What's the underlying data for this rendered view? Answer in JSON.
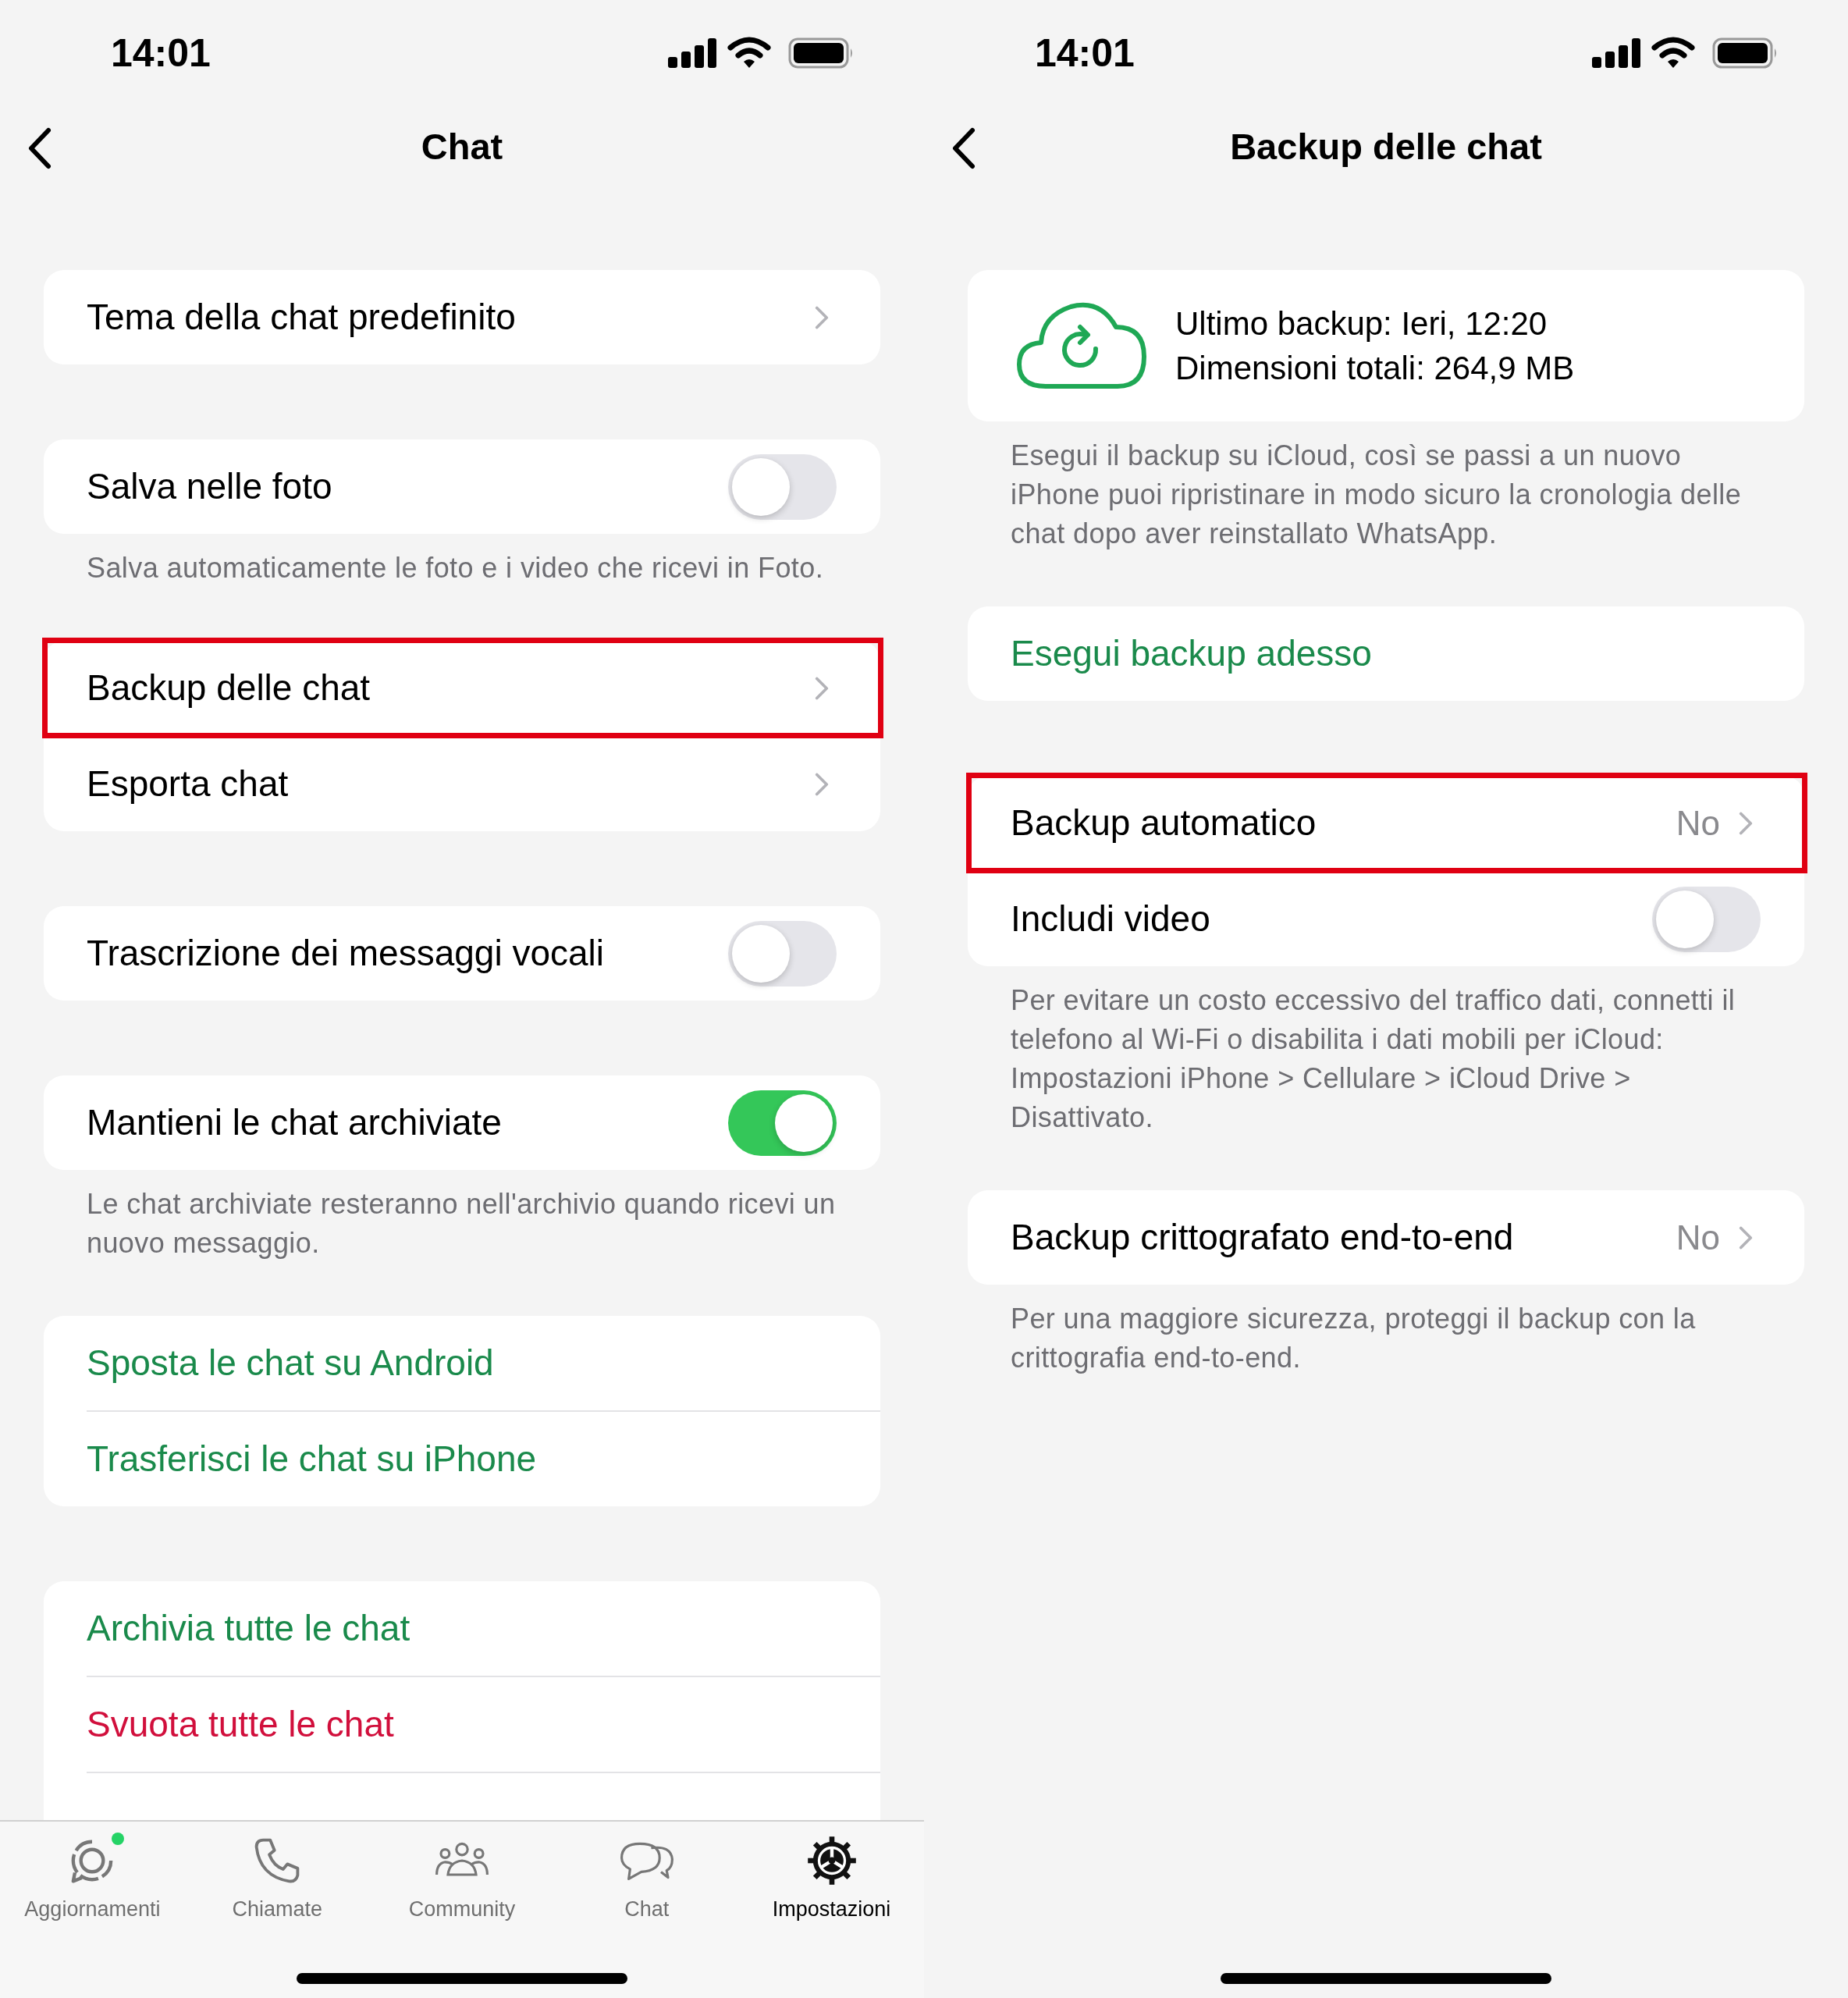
{
  "screens": [
    {
      "status_bar": {
        "time": "14:01"
      },
      "nav": {
        "title": "Chat"
      },
      "groups": [
        {
          "rows": [
            {
              "kind": "link",
              "label": "Tema della chat predefinito",
              "highlighted": false
            }
          ]
        },
        {
          "rows": [
            {
              "kind": "toggle",
              "label": "Salva nelle foto",
              "on": false
            }
          ],
          "footer": "Salva automaticamente le foto e i video che ricevi in Foto."
        },
        {
          "rows": [
            {
              "kind": "link",
              "label": "Backup delle chat",
              "highlighted": true
            },
            {
              "kind": "link",
              "label": "Esporta chat",
              "highlighted": false
            }
          ]
        },
        {
          "rows": [
            {
              "kind": "toggle",
              "label": "Trascrizione dei messaggi vocali",
              "on": false
            }
          ]
        },
        {
          "rows": [
            {
              "kind": "toggle",
              "label": "Mantieni le chat archiviate",
              "on": true
            }
          ],
          "footer": "Le chat archiviate resteranno nell'archivio quando ricevi un nuovo messaggio."
        },
        {
          "rows": [
            {
              "kind": "action",
              "label": "Sposta le chat su Android",
              "color": "#1a8a4b"
            },
            {
              "kind": "action",
              "label": "Trasferisci le chat su iPhone",
              "color": "#1a8a4b"
            }
          ]
        },
        {
          "rows": [
            {
              "kind": "action",
              "label": "Archivia tutte le chat",
              "color": "#1a8a4b"
            },
            {
              "kind": "action",
              "label": "Svuota tutte le chat",
              "color": "#d10f3c"
            }
          ],
          "continues": true
        }
      ],
      "tab_bar": [
        {
          "label": "Aggiornamenti",
          "selected": false,
          "badge": true
        },
        {
          "label": "Chiamate",
          "selected": false,
          "badge": false
        },
        {
          "label": "Community",
          "selected": false,
          "badge": false
        },
        {
          "label": "Chat",
          "selected": false,
          "badge": false
        },
        {
          "label": "Impostazioni",
          "selected": true,
          "badge": false
        }
      ]
    },
    {
      "status_bar": {
        "time": "14:01"
      },
      "nav": {
        "title": "Backup delle chat"
      },
      "groups": [
        {
          "rows": [
            {
              "kind": "info",
              "lines": [
                "Ultimo backup: Ieri, 12:20",
                "Dimensioni totali: 264,9 MB"
              ]
            }
          ],
          "footer": "Esegui il backup su iCloud, così se passi a un nuovo iPhone puoi ripristinare in modo sicuro la cronologia delle chat dopo aver reinstallato WhatsApp."
        },
        {
          "rows": [
            {
              "kind": "action",
              "label": "Esegui backup adesso",
              "color": "#1a8a4b"
            }
          ]
        },
        {
          "rows": [
            {
              "kind": "link",
              "label": "Backup automatico",
              "value": "No",
              "highlighted": true
            },
            {
              "kind": "toggle",
              "label": "Includi video",
              "on": false
            }
          ],
          "footer": "Per evitare un costo eccessivo del traffico dati, connetti il telefono al Wi-Fi o disabilita i dati mobili per iCloud: Impostazioni iPhone > Cellulare > iCloud Drive > Disattivato."
        },
        {
          "rows": [
            {
              "kind": "link",
              "label": "Backup crittografato end-to-end",
              "value": "No",
              "highlighted": false
            }
          ],
          "footer": "Per una maggiore sicurezza, proteggi il backup con la crittografia end-to-end."
        }
      ]
    }
  ]
}
